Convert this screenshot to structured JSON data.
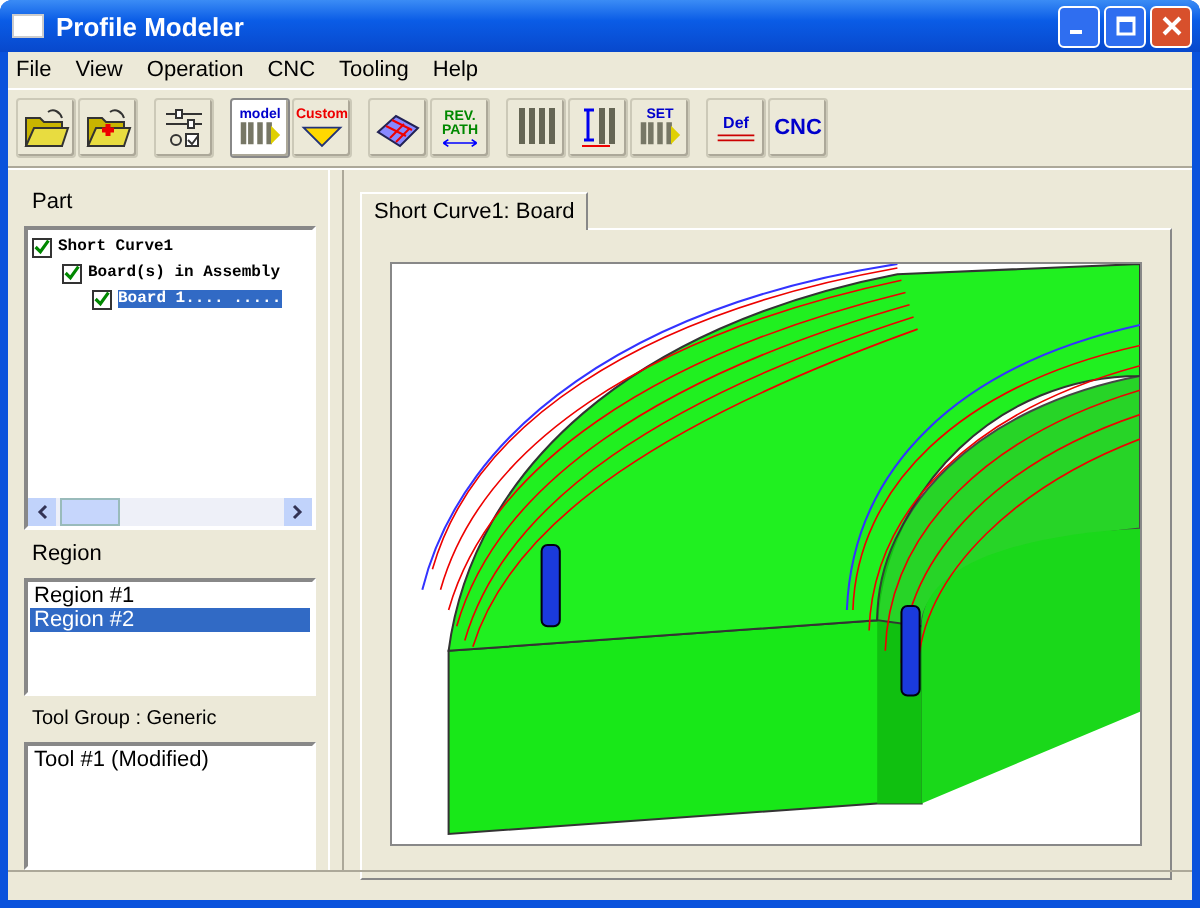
{
  "window": {
    "title": "Profile Modeler"
  },
  "menu": [
    "File",
    "View",
    "Operation",
    "CNC",
    "Tooling",
    "Help"
  ],
  "toolbar": [
    [
      {
        "kind": "open"
      },
      {
        "kind": "open-add"
      }
    ],
    [
      {
        "kind": "settings"
      }
    ],
    [
      {
        "kind": "model",
        "label": "model",
        "selected": true
      },
      {
        "kind": "custom",
        "label": "Custom",
        "selected": false
      }
    ],
    [
      {
        "kind": "surface",
        "selected": false
      },
      {
        "kind": "revpath",
        "label": "REV. PATH",
        "selected": false
      }
    ],
    [
      {
        "kind": "tools",
        "selected": false
      },
      {
        "kind": "measure",
        "selected": false
      },
      {
        "kind": "set",
        "label": "SET",
        "selected": false
      }
    ],
    [
      {
        "kind": "def",
        "label": "Def",
        "selected": false
      },
      {
        "kind": "cnc",
        "label": "CNC",
        "selected": false
      }
    ]
  ],
  "part": {
    "label": "Part",
    "tree": [
      {
        "label": "Short Curve1",
        "checked": true,
        "selected": false,
        "children": [
          {
            "label": "Board(s) in Assembly",
            "checked": true,
            "selected": false,
            "children": [
              {
                "label": "Board 1.... .....",
                "checked": true,
                "selected": true
              }
            ]
          }
        ]
      }
    ]
  },
  "region": {
    "label": "Region",
    "items": [
      {
        "label": "Region #1",
        "selected": false
      },
      {
        "label": "Region #2",
        "selected": true
      }
    ]
  },
  "tool_group": {
    "label": "Tool Group : Generic",
    "items": [
      {
        "label": "Tool #1 (Modified)",
        "selected": false
      }
    ]
  },
  "tabs": [
    {
      "label": "Short Curve1: Board",
      "selected": true
    }
  ]
}
